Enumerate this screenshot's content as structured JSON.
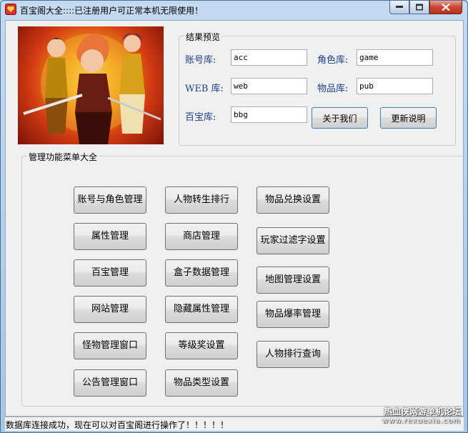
{
  "window": {
    "title": "百宝阁大全::::已注册用户可正常本机无限使用！"
  },
  "preview": {
    "group_title": "结果预览",
    "account_label": "账号库:",
    "account_value": "acc",
    "role_label": "角色库:",
    "role_value": "game",
    "web_label": "WEB 库:",
    "web_value": "web",
    "item_label": "物品库:",
    "item_value": "pub",
    "treasure_label": "百宝库:",
    "treasure_value": "bbg",
    "about_button": "关于我们",
    "update_button": "更新说明"
  },
  "menu": {
    "group_title": "管理功能菜单大全",
    "col1": [
      "账号与角色管理",
      "属性管理",
      "百宝管理",
      "网站管理",
      "怪物管理窗口",
      "公告管理窗口"
    ],
    "col2": [
      "人物转生排行",
      "商店管理",
      "盒子数据管理",
      "隐藏属性管理",
      "等级奖设置",
      "物品类型设置"
    ],
    "col3": [
      "物品兑换设置",
      "玩家过滤字设置",
      "地图管理设置",
      "物品爆率管理",
      "人物排行查询"
    ]
  },
  "status": {
    "text": "数据库连接成功，现在可以对百宝阁进行操作了！！！！！"
  },
  "watermark": {
    "line1": "热血侠网游单机论坛",
    "line2": "www.rexuexia.com"
  },
  "icons": {
    "app": "heart-badge-icon",
    "minimize": "minimize-icon",
    "maximize": "maximize-icon",
    "close": "close-icon"
  },
  "colors": {
    "label_blue": "#1d3f86",
    "title_bar": "#c4daf1",
    "close_red": "#c94630"
  }
}
